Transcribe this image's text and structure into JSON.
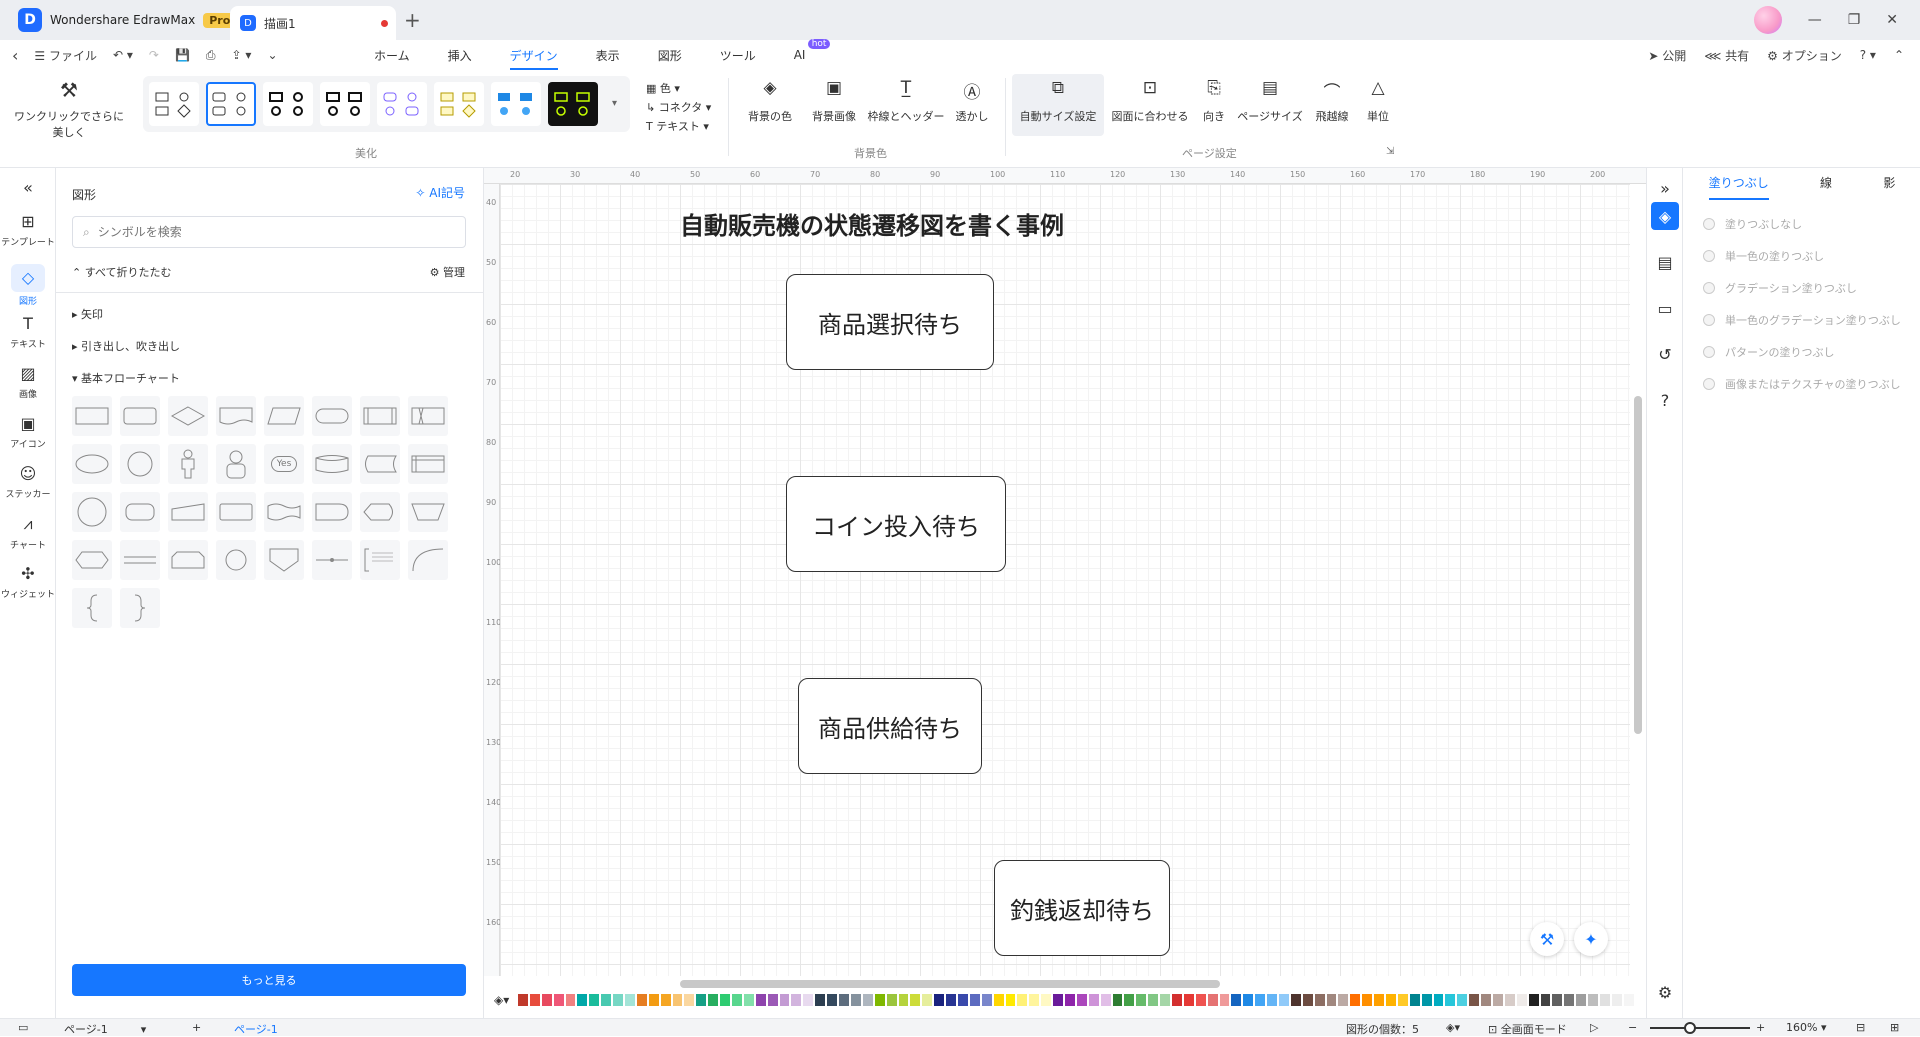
{
  "app": {
    "name": "Wondershare EdrawMax",
    "badge": "Pro",
    "doc_tab": "描画1"
  },
  "menu": {
    "file": "ファイル",
    "tabs": [
      "ホーム",
      "挿入",
      "デザイン",
      "表示",
      "図形",
      "ツール",
      "AI"
    ],
    "hot": "hot",
    "publish": "公開",
    "share": "共有",
    "options": "オプション"
  },
  "ribbon": {
    "oneclick": "ワンクリックでさらに美しく",
    "group_beautify": "美化",
    "color": "色",
    "connector": "コネクタ",
    "text": "テキスト",
    "bg_color": "背景の色",
    "bg_image": "背景画像",
    "border_header": "枠線とヘッダー",
    "watermark": "透かし",
    "group_background": "背景色",
    "auto_size": "自動サイズ設定",
    "fit_drawing": "図面に合わせる",
    "orientation": "向き",
    "page_size": "ページサイズ",
    "jump_line": "飛越線",
    "unit": "単位",
    "group_page": "ページ設定"
  },
  "leftbar": [
    "テンプレート",
    "図形",
    "テキスト",
    "画像",
    "アイコン",
    "ステッカー",
    "チャート",
    "ウィジェット"
  ],
  "panel": {
    "title": "図形",
    "ai_symbol": "AI記号",
    "search_placeholder": "シンボルを検索",
    "collapse_all": "すべて折りたたむ",
    "manage": "管理",
    "categories": [
      "矢印",
      "引き出し、吹き出し",
      "基本フローチャート"
    ],
    "yes_label": "Yes",
    "more": "もっと見る"
  },
  "canvas": {
    "title": "自動販売機の状態遷移図を書く事例",
    "states": [
      "商品選択待ち",
      "コイン投入待ち",
      "商品供給待ち",
      "釣銭返却待ち"
    ],
    "hruler": [
      "20",
      "30",
      "40",
      "50",
      "60",
      "70",
      "80",
      "90",
      "100",
      "110",
      "120",
      "130",
      "140",
      "150",
      "160",
      "170",
      "180",
      "190",
      "200"
    ],
    "vruler": [
      "40",
      "50",
      "60",
      "70",
      "80",
      "90",
      "100",
      "110",
      "120",
      "130",
      "140",
      "150",
      "160"
    ]
  },
  "right_panel": {
    "tabs": [
      "塗りつぶし",
      "線",
      "影"
    ],
    "fill_options": [
      "塗りつぶしなし",
      "単一色の塗りつぶし",
      "グラデーション塗りつぶし",
      "単一色のグラデーション塗りつぶし",
      "パターンの塗りつぶし",
      "画像またはテクスチャの塗りつぶし"
    ]
  },
  "status": {
    "page_dropdown": "ページ-1",
    "page_tab": "ページ-1",
    "shape_count": "図形の個数：5",
    "fullscreen": "全画面モード",
    "zoom": "160%"
  },
  "colors": {
    "accent": "#1677ff",
    "palette": [
      "#c0392b",
      "#e74c3c",
      "#e84a5f",
      "#ef5777",
      "#f08080",
      "#00a8a8",
      "#1abc9c",
      "#48c9b0",
      "#76d7c4",
      "#a3e4d7",
      "#e67e22",
      "#f39c12",
      "#f5a623",
      "#f8c471",
      "#fad7a0",
      "#16a085",
      "#27ae60",
      "#2ecc71",
      "#58d68d",
      "#82e0aa",
      "#8e44ad",
      "#9b59b6",
      "#c39bd3",
      "#d2b4de",
      "#e8daef",
      "#2c3e50",
      "#34495e",
      "#5d6d7e",
      "#85929e",
      "#aeb6bf",
      "#7fb800",
      "#9bc53d",
      "#b5d33d",
      "#cddc39",
      "#e6ee9c",
      "#1a237e",
      "#283593",
      "#3949ab",
      "#5c6bc0",
      "#7986cb",
      "#ffd600",
      "#ffea00",
      "#fff176",
      "#fff59d",
      "#fff9c4",
      "#6a1b9a",
      "#8e24aa",
      "#ab47bc",
      "#ce93d8",
      "#e1bee7",
      "#2e7d32",
      "#43a047",
      "#66bb6a",
      "#81c784",
      "#a5d6a7",
      "#d32f2f",
      "#e53935",
      "#ef5350",
      "#e57373",
      "#ef9a9a",
      "#1565c0",
      "#1e88e5",
      "#42a5f5",
      "#64b5f6",
      "#90caf9",
      "#4e342e",
      "#6d4c41",
      "#8d6e63",
      "#a1887f",
      "#bcaaa4",
      "#ff6f00",
      "#ff8f00",
      "#ffa000",
      "#ffb300",
      "#ffca28",
      "#00838f",
      "#0097a7",
      "#00acc1",
      "#26c6da",
      "#4dd0e1",
      "#795548",
      "#a1887f",
      "#bcaaa4",
      "#d7ccc8",
      "#efebe9",
      "#212121",
      "#424242",
      "#616161",
      "#757575",
      "#9e9e9e",
      "#bdbdbd",
      "#e0e0e0",
      "#eeeeee",
      "#f5f5f5",
      "#ffffff"
    ]
  }
}
